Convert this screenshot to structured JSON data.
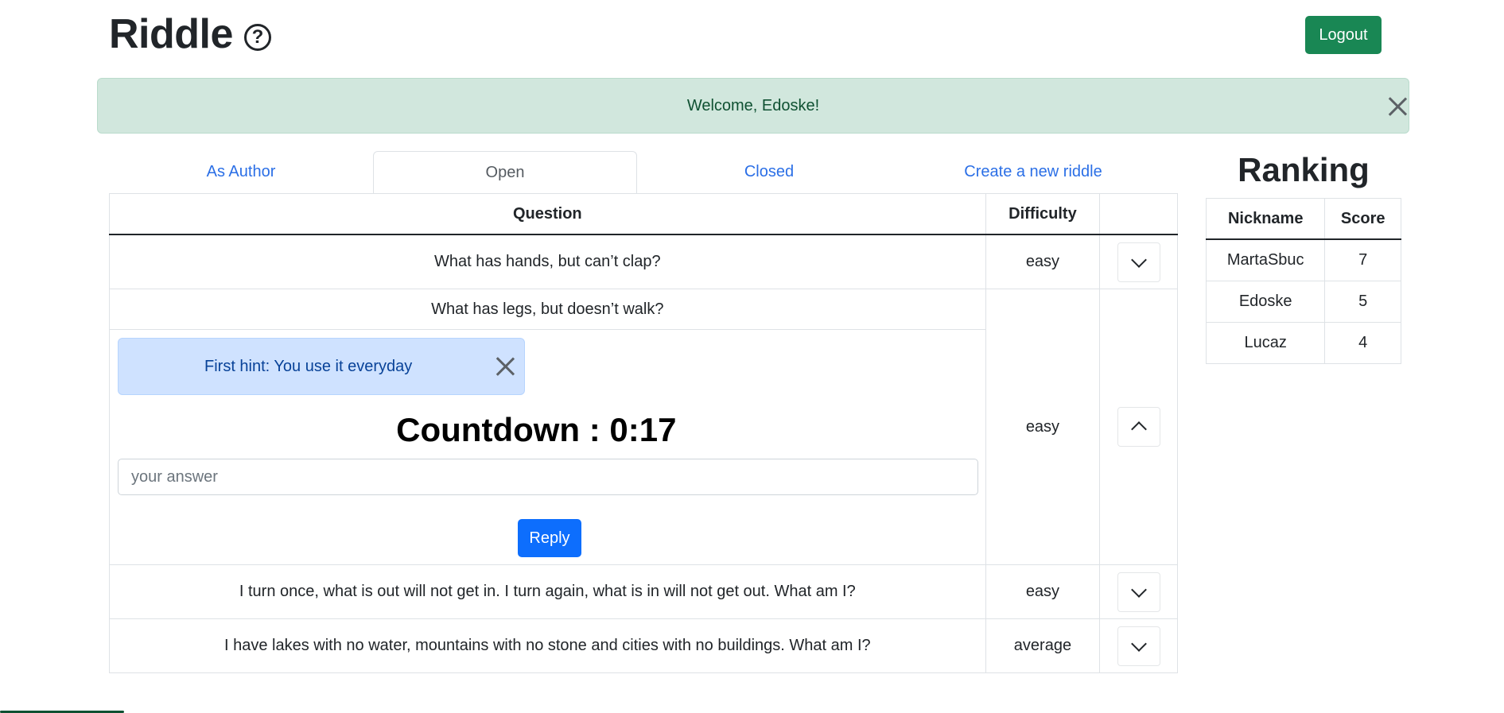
{
  "header": {
    "title": "Riddle",
    "help_icon": "question-circle-icon",
    "logout_label": "Logout"
  },
  "alert": {
    "message": "Welcome, Edoske!"
  },
  "tabs": [
    {
      "label": "As Author"
    },
    {
      "label": "Open",
      "active": true
    },
    {
      "label": "Closed"
    },
    {
      "label": "Create a new riddle"
    }
  ],
  "riddles_table": {
    "headers": {
      "question": "Question",
      "difficulty": "Difficulty"
    },
    "rows": [
      {
        "question": "What has hands, but can’t clap?",
        "difficulty": "easy",
        "expanded": false
      },
      {
        "question": "What has legs, but doesn’t walk?",
        "difficulty": "easy",
        "expanded": true,
        "hint": "First hint: You use it everyday",
        "countdown": "Countdown : 0:17",
        "answer_placeholder": "your answer",
        "reply_label": "Reply"
      },
      {
        "question": "I turn once, what is out will not get in. I turn again, what is in will not get out. What am I?",
        "difficulty": "easy",
        "expanded": false
      },
      {
        "question": "I have lakes with no water, mountains with no stone and cities with no buildings. What am I?",
        "difficulty": "average",
        "expanded": false
      }
    ]
  },
  "ranking": {
    "title": "Ranking",
    "headers": {
      "nickname": "Nickname",
      "score": "Score"
    },
    "rows": [
      {
        "nickname": "MartaSbuc",
        "score": "7"
      },
      {
        "nickname": "Edoske",
        "score": "5"
      },
      {
        "nickname": "Lucaz",
        "score": "4"
      }
    ]
  },
  "colors": {
    "success": "#198754",
    "primary": "#0d6efd",
    "link": "#2b6fe6",
    "alert_success_bg": "#d1e7dd",
    "alert_info_bg": "#cfe2ff"
  }
}
